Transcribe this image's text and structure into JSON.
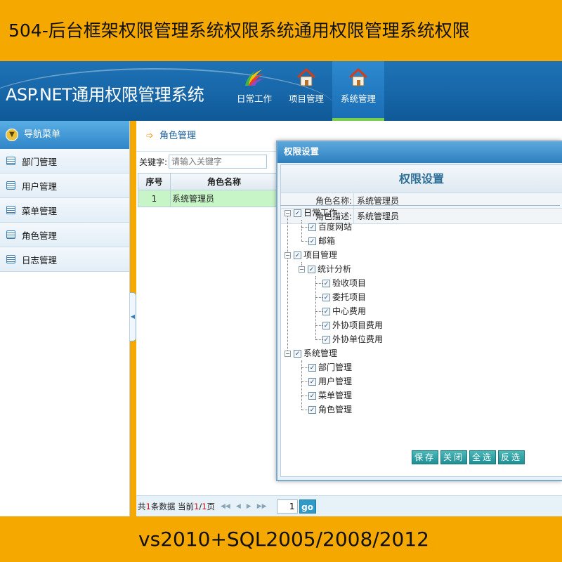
{
  "banner": {
    "top": "504-后台框架权限管理系统权限系统通用权限管理系统权限",
    "bottom": "vs2010+SQL2005/2008/2012"
  },
  "app": {
    "title": "ASP.NET通用权限管理系统"
  },
  "nav": {
    "items": [
      {
        "label": "日常工作",
        "icon": "brush-logo-icon",
        "active": false
      },
      {
        "label": "项目管理",
        "icon": "home-icon",
        "active": false
      },
      {
        "label": "系统管理",
        "icon": "home-icon",
        "active": true
      }
    ]
  },
  "sidebar": {
    "header": "导航菜单",
    "items": [
      {
        "label": "部门管理",
        "icon": "list-icon"
      },
      {
        "label": "用户管理",
        "icon": "list-icon"
      },
      {
        "label": "菜单管理",
        "icon": "list-icon"
      },
      {
        "label": "角色管理",
        "icon": "list-icon"
      },
      {
        "label": "日志管理",
        "icon": "list-icon"
      }
    ]
  },
  "main": {
    "title": "角色管理",
    "search": {
      "label": "关键字:",
      "placeholder": "请输入关键字"
    },
    "table": {
      "headers": [
        "序号",
        "角色名称"
      ],
      "rows": [
        {
          "index": "1",
          "name": "系统管理员"
        }
      ]
    },
    "pager": {
      "text_total_prefix": "共",
      "total": "1",
      "text_total_suffix": "条数据 当前",
      "current": "1",
      "sep": "/",
      "pages": "1",
      "text_page": "页",
      "input_value": "1",
      "go_label": "go"
    }
  },
  "dialog": {
    "header": "权限设置",
    "title": "权限设置",
    "role_name_label": "角色名称:",
    "role_name": "系统管理员",
    "role_desc_label": "角色描述:",
    "role_desc": "系统管理员",
    "tree": {
      "daily": "日常工作",
      "baidu": "百度网站",
      "mail": "邮箱",
      "project": "项目管理",
      "stats": "统计分析",
      "accept": "验收项目",
      "entrust": "委托项目",
      "center_cost": "中心费用",
      "outsource_project_cost": "外协项目费用",
      "outsource_unit_cost": "外协单位费用",
      "system": "系统管理",
      "dept": "部门管理",
      "user": "用户管理",
      "menu": "菜单管理",
      "role": "角色管理"
    },
    "buttons": {
      "save": "保存",
      "close": "关闭",
      "select_all": "全选",
      "invert": "反选"
    }
  }
}
